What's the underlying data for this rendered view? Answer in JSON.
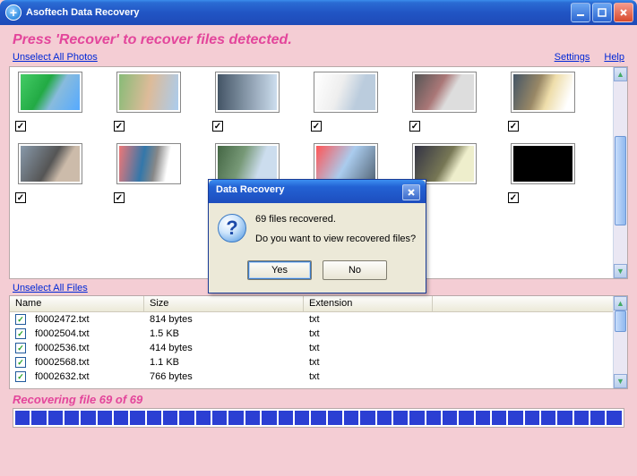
{
  "window": {
    "title": "Asoftech Data Recovery"
  },
  "hint": "Press 'Recover' to recover files detected.",
  "links": {
    "unselect_photos": "Unselect All Photos",
    "unselect_files": "Unselect All Files",
    "settings": "Settings",
    "help": "Help"
  },
  "photos": [
    {
      "checked": true
    },
    {
      "checked": true
    },
    {
      "checked": true
    },
    {
      "checked": true
    },
    {
      "checked": true
    },
    {
      "checked": true
    },
    {
      "checked": true
    },
    {
      "checked": true
    },
    {
      "checked": true
    },
    {
      "checked": true
    },
    {
      "checked": true
    },
    {
      "checked": true
    }
  ],
  "file_table": {
    "columns": {
      "name": "Name",
      "size": "Size",
      "extension": "Extension"
    },
    "rows": [
      {
        "name": "f0002472.txt",
        "size": "814 bytes",
        "ext": "txt",
        "checked": true
      },
      {
        "name": "f0002504.txt",
        "size": "1.5 KB",
        "ext": "txt",
        "checked": true
      },
      {
        "name": "f0002536.txt",
        "size": "414 bytes",
        "ext": "txt",
        "checked": true
      },
      {
        "name": "f0002568.txt",
        "size": "1.1 KB",
        "ext": "txt",
        "checked": true
      },
      {
        "name": "f0002632.txt",
        "size": "766 bytes",
        "ext": "txt",
        "checked": true
      }
    ]
  },
  "status": "Recovering file 69 of 69",
  "dialog": {
    "title": "Data Recovery",
    "line1": "69 files recovered.",
    "line2": "Do you want to view recovered files?",
    "yes": "Yes",
    "no": "No"
  }
}
